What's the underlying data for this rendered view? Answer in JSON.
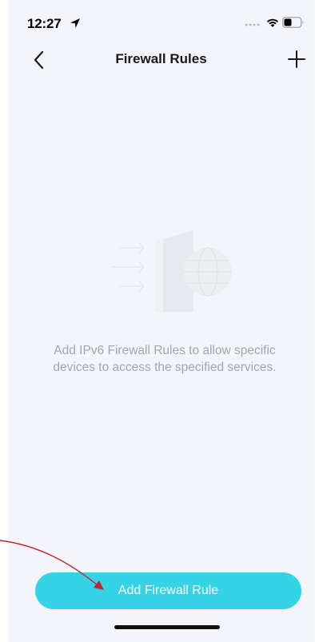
{
  "status_bar": {
    "time": "12:27"
  },
  "nav": {
    "title": "Firewall Rules"
  },
  "empty_state": {
    "message": "Add IPv6 Firewall Rules to allow specific devices to access the specified services."
  },
  "primary_button": {
    "label": "Add Firewall Rule"
  },
  "colors": {
    "background": "#f4f5fa",
    "accent": "#35d3e6",
    "annotation_arrow": "#c0262f"
  },
  "icons": [
    "location-icon",
    "wifi-icon",
    "battery-icon",
    "back-chevron-icon",
    "plus-icon",
    "firewall-illustration",
    "annotation-arrow"
  ]
}
